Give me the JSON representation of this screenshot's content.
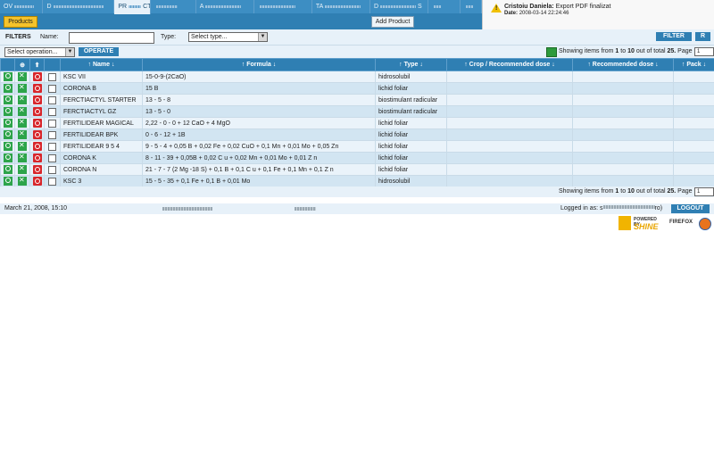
{
  "tabs": [
    "OV",
    "D",
    "PR",
    "",
    "A",
    "",
    "TA",
    "D",
    "",
    ""
  ],
  "tabs_visible_suffix": [
    "",
    "",
    "CTS",
    "",
    "",
    "",
    "",
    "S",
    "",
    ""
  ],
  "active_tab_index": 2,
  "toolbar": {
    "products_label": "Products",
    "add_product_label": "Add Product"
  },
  "notice": {
    "author": "Cristoiu Daniela:",
    "message": "Export PDF finalizat",
    "date_label": "Date:",
    "date_value": "2008-03-14 22:24:46"
  },
  "filters": {
    "title": "FILTERS",
    "name_label": "Name:",
    "name_value": "",
    "type_label": "Type:",
    "type_value": "Select type...",
    "filter_button": "FILTER",
    "reset_button": "R"
  },
  "operations": {
    "select_value": "Select operation...",
    "operate_button": "OPERATE"
  },
  "paging": {
    "prefix": "Showing items from",
    "from": "1",
    "to_word": "to",
    "to": "10",
    "total_word": "out of total",
    "total": "25.",
    "page_word": "Page",
    "page": "1"
  },
  "table": {
    "headers": {
      "name": "Name",
      "formula": "Formula",
      "type": "Type",
      "crop": "Crop / Recommended dose",
      "recommended": "Recommended dose",
      "pack": "Pack"
    },
    "rows": [
      {
        "name": "KSC VII",
        "formula": "15-0-9-(2CaO)",
        "type": "hidrosolubil"
      },
      {
        "name": "CORONA B",
        "formula": "15 B",
        "type": "lichid foliar"
      },
      {
        "name": "FERCTIACTYL STARTER",
        "formula": "13 - 5 - 8",
        "type": "biostimulant radicular"
      },
      {
        "name": "FERCTIACTYL GZ",
        "formula": "13 - 5 - 0",
        "type": "biostimulant radicular"
      },
      {
        "name": "FERTILIDEAR MAGICAL",
        "formula": "2,22 - 0 - 0 + 12 CaO + 4 MgO",
        "type": "lichid foliar"
      },
      {
        "name": "FERTILIDEAR BPK",
        "formula": "0 - 6 - 12 + 1B",
        "type": "lichid foliar"
      },
      {
        "name": "FERTILIDEAR 9 5 4",
        "formula": "9 - 5 - 4 + 0,05 B + 0,02 Fe + 0,02 CuO + 0,1 Mn + 0,01 Mo + 0,05 Zn",
        "type": "lichid foliar"
      },
      {
        "name": "CORONA K",
        "formula": "8 - 11 - 39 + 0,05B + 0,02 C u + 0,02 Mn + 0,01 Mo + 0,01 Z n",
        "type": "lichid foliar"
      },
      {
        "name": "CORONA N",
        "formula": "21 - 7 - 7 (2 Mg -18 S) + 0,1 B + 0,1 C u + 0,1 Fe + 0,1 Mn + 0,1 Z n",
        "type": "lichid foliar"
      },
      {
        "name": "KSC 3",
        "formula": "15 - 5 - 35 + 0,1 Fe + 0,1 B + 0,01 Mo",
        "type": "hidrosolubil"
      }
    ]
  },
  "footer": {
    "date": "March 21, 2008, 15:10",
    "logged_label": "Logged in as:",
    "logged_user_prefix": "s",
    "logged_user_suffix": "ro)",
    "logout_button": "LOGOUT"
  },
  "logos": {
    "powered_by": "POWERED BY",
    "shine": "SHINE",
    "firefox": "FIREFOX"
  }
}
